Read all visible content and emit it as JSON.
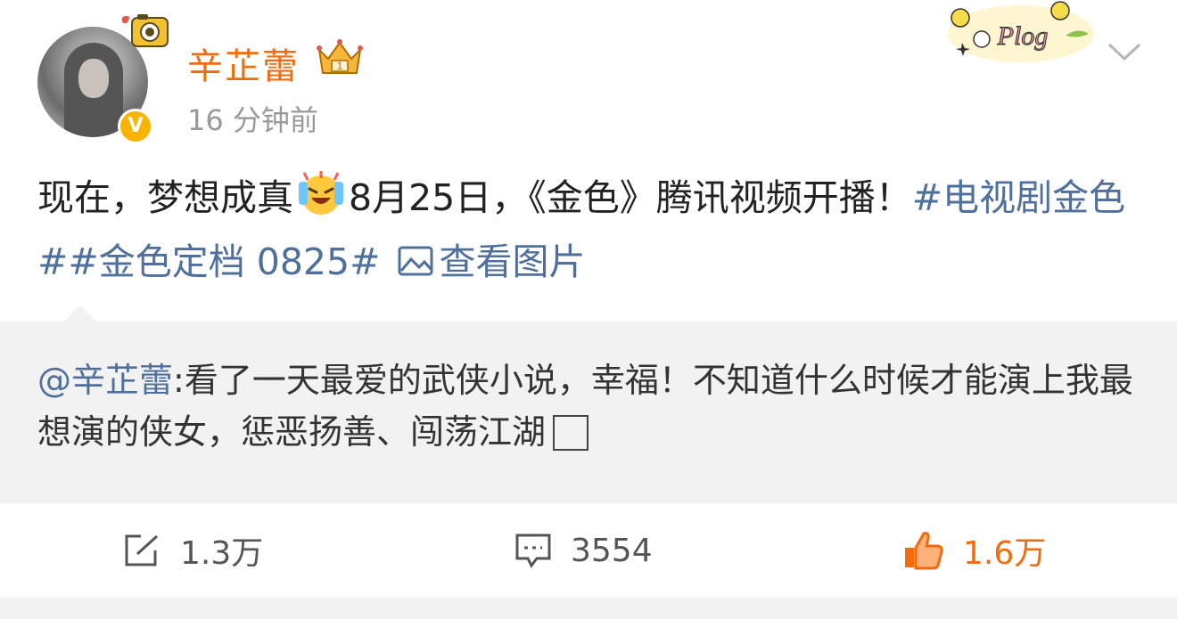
{
  "header": {
    "username": "辛芷蕾",
    "timestamp": "16 分钟前",
    "sticker_text": "Plog",
    "avatar_badge": "V"
  },
  "content": {
    "text_main": "现在，梦想成真",
    "text_after_emoji": "8月25日，《金色》腾讯视频开播！",
    "topic1": "#电视剧金色#",
    "topic2": "#金色定档 0825#",
    "view_images": "查看图片"
  },
  "repost": {
    "mention": "@辛芷蕾",
    "text": ":看了一天最爱的武侠小说，幸福！不知道什么时候才能演上我最想演的侠女，惩恶扬善、闯荡江湖"
  },
  "actions": {
    "repost_count": "1.3万",
    "comment_count": "3554",
    "like_count": "1.6万"
  },
  "colors": {
    "username": "#f26b0f",
    "link": "#50709c",
    "like": "#f26b0f",
    "repost_bg": "#f2f2f2"
  },
  "icons": {
    "repost": "edit-repost-icon",
    "comment": "comment-icon",
    "like": "thumbs-up-icon",
    "more": "chevron-down-icon",
    "picture": "image-icon",
    "emoji": "crying-laughing-emoji"
  }
}
